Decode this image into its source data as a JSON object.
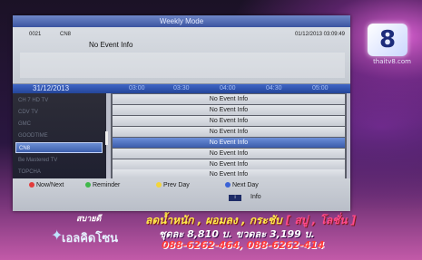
{
  "window": {
    "title": "Weekly Mode"
  },
  "event_info": {
    "channel_number": "0021",
    "channel_name": "CN8",
    "date_time": "01/12/2013 03:09:49",
    "event_title": "No Event Info"
  },
  "timeline": {
    "date": "31/12/2013",
    "times": [
      "03:00",
      "03:30",
      "04:00",
      "04:30",
      "05:00"
    ]
  },
  "channels": {
    "items": [
      {
        "label": "CH 7 HD TV",
        "selected": false
      },
      {
        "label": "CDV TV",
        "selected": false
      },
      {
        "label": "GMC",
        "selected": false
      },
      {
        "label": "GOODTIME",
        "selected": false
      },
      {
        "label": "CN8",
        "selected": true
      },
      {
        "label": "Be Mastered TV",
        "selected": false
      },
      {
        "label": "TOPCHA",
        "selected": false
      }
    ]
  },
  "events": {
    "items": [
      {
        "label": "No Event Info",
        "selected": false
      },
      {
        "label": "No Event Info",
        "selected": false
      },
      {
        "label": "No Event Info",
        "selected": false
      },
      {
        "label": "No Event Info",
        "selected": false
      },
      {
        "label": "No Event Info",
        "selected": true
      },
      {
        "label": "No Event Info",
        "selected": false
      },
      {
        "label": "No Event Info",
        "selected": false
      },
      {
        "label": "No Event Info",
        "selected": false
      }
    ]
  },
  "legend": {
    "red_label": "Now/Next",
    "green_label": "Reminder",
    "yellow_label": "Prev Day",
    "blue_label": "Next Day",
    "info_key": "i",
    "info_label": "Info"
  },
  "colors": {
    "red": "#e23b3b",
    "green": "#3fb84a",
    "yellow": "#f3d53b",
    "blue": "#3b63d6",
    "accent": "#3f66c6"
  },
  "background": {
    "logo_text": "8",
    "url_text": "thaitv8.com",
    "promo_line1_a": "ลดน้ำหนัก",
    "promo_line1_b": "ผอมลง",
    "promo_line1_c": "กระชับ",
    "promo_line1_d": "[ สบู่ , โลชั่น ]",
    "promo_line2": "ชุดละ 8,810 บ. ขวดละ 3,199 บ.",
    "promo_line3": "088-6262-464, 088-6262-414",
    "brand_text": "เอลคิดโซน",
    "thai_tag": "สบายดี"
  }
}
